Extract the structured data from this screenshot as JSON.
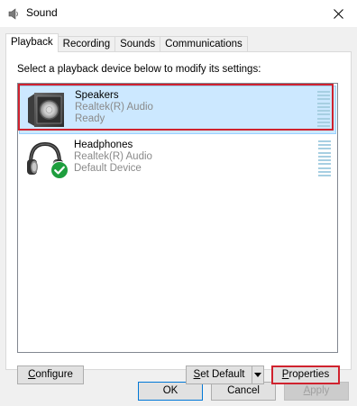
{
  "window": {
    "title": "Sound",
    "close_symbol": "✕"
  },
  "tabs": [
    {
      "label": "Playback",
      "active": true
    },
    {
      "label": "Recording",
      "active": false
    },
    {
      "label": "Sounds",
      "active": false
    },
    {
      "label": "Communications",
      "active": false
    }
  ],
  "playback": {
    "instruction": "Select a playback device below to modify its settings:",
    "devices": [
      {
        "name": "Speakers",
        "driver": "Realtek(R) Audio",
        "status": "Ready",
        "icon": "speaker-icon",
        "selected": true
      },
      {
        "name": "Headphones",
        "driver": "Realtek(R) Audio",
        "status": "Default Device",
        "icon": "headphones-icon",
        "selected": false,
        "default_badge": "checkmark-icon"
      }
    ]
  },
  "buttons": {
    "configure_first": "C",
    "configure_rest": "onfigure",
    "set_default_first": "S",
    "set_default_rest": "et Default",
    "properties_first": "P",
    "properties_rest": "roperties",
    "ok": "OK",
    "cancel": "Cancel",
    "apply_first": "A",
    "apply_rest": "pply"
  },
  "colors": {
    "selection_bg": "#cce8ff",
    "highlight_red": "#d0222e",
    "default_badge_green": "#1e9e3e",
    "ok_border": "#0078d7"
  }
}
